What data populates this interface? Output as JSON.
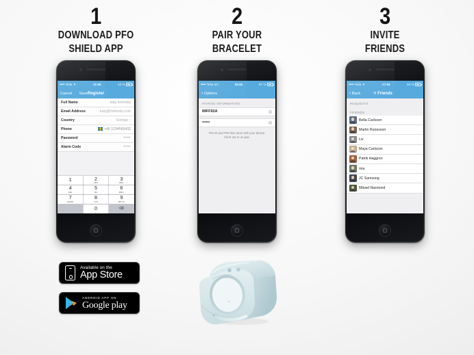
{
  "page": {
    "background_color": "#f2f2f2",
    "accent_blue": "#57aadd",
    "bracelet_color": "#cfe2e6"
  },
  "steps": [
    {
      "number": "1",
      "title_lines": [
        "DOWNLOAD PFO",
        "SHIELD APP"
      ],
      "phone": {
        "status_bar": {
          "signal": "•••••",
          "carrier": "Telia",
          "wifi": "▼",
          "time": "11:55",
          "battery_pct": "42 %"
        },
        "nav": {
          "left": "Cancel",
          "title": "Register",
          "right": "Save"
        },
        "form_rows": [
          {
            "label": "Full Name",
            "value": "katy holmsby",
            "type": "text"
          },
          {
            "label": "Email Address",
            "value": "katy@holmsby.com",
            "type": "text"
          },
          {
            "label": "Country",
            "value": "Sverige",
            "type": "disclosure"
          },
          {
            "label": "Phone",
            "value": "1234565432",
            "prefix": "+46",
            "flag": "swedish-flag",
            "type": "phone"
          },
          {
            "label": "Password",
            "value": "••••",
            "type": "secure"
          },
          {
            "label": "Alarm Code",
            "value": "••••",
            "type": "secure"
          }
        ],
        "keypad": [
          [
            {
              "num": "1",
              "sub": ""
            },
            {
              "num": "2",
              "sub": "ABC"
            },
            {
              "num": "3",
              "sub": "DEF"
            }
          ],
          [
            {
              "num": "4",
              "sub": "GHI"
            },
            {
              "num": "5",
              "sub": "JKL"
            },
            {
              "num": "6",
              "sub": "MNO"
            }
          ],
          [
            {
              "num": "7",
              "sub": "PQRS"
            },
            {
              "num": "8",
              "sub": "TUV"
            },
            {
              "num": "9",
              "sub": "WXYZ"
            }
          ],
          [
            {
              "num": "",
              "sub": ""
            },
            {
              "num": "0",
              "sub": ""
            },
            {
              "num": "delete-icon",
              "sub": ""
            }
          ]
        ]
      }
    },
    {
      "number": "2",
      "title_lines": [
        "PAIR YOUR",
        "BRACELET"
      ],
      "phone": {
        "status_bar": {
          "signal": "•••••",
          "carrier": "Telia",
          "wifi": "4G",
          "time": "16:52",
          "battery_pct": "87 %"
        },
        "nav": {
          "left": "Options",
          "title": "",
          "right": ""
        },
        "section_header": "PAIRING INFORMATION",
        "pair_rows": [
          {
            "value": "89FF92A",
            "clear": "clear-icon"
          },
          {
            "value": "••••••",
            "clear": "clear-icon"
          }
        ],
        "note_lines": [
          "The ID and PIN that came with your device.",
          "Clear out to un-pair."
        ]
      }
    },
    {
      "number": "3",
      "title_lines": [
        "INVITE",
        "FRIENDS"
      ],
      "phone": {
        "status_bar": {
          "signal": "•••••",
          "carrier": "Telia",
          "wifi": "▼",
          "time": "17:53",
          "battery_pct": "94 %"
        },
        "nav": {
          "left": "Back",
          "title": "Friends",
          "right": "+"
        },
        "sections": [
          {
            "header": "REQUESTS",
            "items": []
          },
          {
            "header": "FRIENDS",
            "items": [
              {
                "name": "Bella Carlsson",
                "avatar_tint": "#5a6f86"
              },
              {
                "name": "Martin Runesson",
                "avatar_tint": "#7c6652"
              },
              {
                "name": "Liv",
                "avatar_tint": "#8a8f94"
              },
              {
                "name": "Maya Carlsson",
                "avatar_tint": "#c9b49a"
              },
              {
                "name": "Patrik Haggren",
                "avatar_tint": "#a4643f"
              },
              {
                "name": "mia",
                "avatar_tint": "#6f7c68"
              },
              {
                "name": "JC Samsung",
                "avatar_tint": "#44484f"
              },
              {
                "name": "Mikael Naeslund",
                "avatar_tint": "#4e5a3c"
              }
            ]
          }
        ]
      }
    }
  ],
  "store_badges": [
    {
      "id": "app-store-badge",
      "small_text": "Available on the",
      "big_text": "App Store",
      "icon": "iphone-icon"
    },
    {
      "id": "google-play-badge",
      "small_text": "ANDROID APP ON",
      "big_text": "Google play",
      "icon": "play-triangle-icon"
    }
  ],
  "product": {
    "name": "bracelet-render",
    "color": "#cfe2e6"
  }
}
